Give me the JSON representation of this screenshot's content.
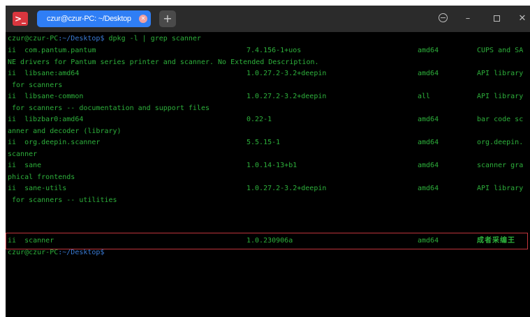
{
  "titlebar": {
    "app_icon": "terminal-icon",
    "tab_title": "czur@czur-PC: ~/Desktop",
    "add_tab_label": "+",
    "window_buttons": {
      "menu": "menu-icon",
      "minimize": "–",
      "maximize": "maximize-icon",
      "close": "✕"
    }
  },
  "terminal": {
    "prompt_user": "czur@czur-PC",
    "prompt_path": ":~/Desktop$",
    "command": " dpkg -l | grep scanner",
    "rows": [
      {
        "pkg": "ii  com.pantum.pantum",
        "ver": "7.4.156-1+uos",
        "arch": "amd64",
        "desc": "CUPS and SA"
      },
      {
        "line": "NE drivers for Pantum series printer and scanner. No Extended Description."
      },
      {
        "pkg": "ii  libsane:amd64",
        "ver": "1.0.27.2-3.2+deepin",
        "arch": "amd64",
        "desc": "API library"
      },
      {
        "line": " for scanners"
      },
      {
        "pkg": "ii  libsane-common",
        "ver": "1.0.27.2-3.2+deepin",
        "arch": "all",
        "desc": "API library"
      },
      {
        "line": " for scanners -- documentation and support files"
      },
      {
        "pkg": "ii  libzbar0:amd64",
        "ver": "0.22-1",
        "arch": "amd64",
        "desc": "bar code sc"
      },
      {
        "line": "anner and decoder (library)"
      },
      {
        "pkg": "ii  org.deepin.scanner",
        "ver": "5.5.15-1",
        "arch": "amd64",
        "desc": "org.deepin."
      },
      {
        "line": "scanner"
      },
      {
        "pkg": "ii  sane",
        "ver": "1.0.14-13+b1",
        "arch": "amd64",
        "desc": "scanner gra"
      },
      {
        "line": "phical frontends"
      },
      {
        "pkg": "ii  sane-utils",
        "ver": "1.0.27.2-3.2+deepin",
        "arch": "amd64",
        "desc": "API library"
      },
      {
        "line": " for scanners -- utilities"
      }
    ],
    "highlighted_row": {
      "pkg": "ii  scanner",
      "ver": "1.0.230906a",
      "arch": "amd64",
      "desc": "成者采编王"
    },
    "final_prompt_user": "czur@czur-PC",
    "final_prompt_path": ":~/Desktop$"
  },
  "colors": {
    "terminal_text": "#2db03b",
    "prompt_path": "#3a7bd5",
    "tab_active": "#2f7ef5",
    "highlight_border": "#c0343c"
  }
}
